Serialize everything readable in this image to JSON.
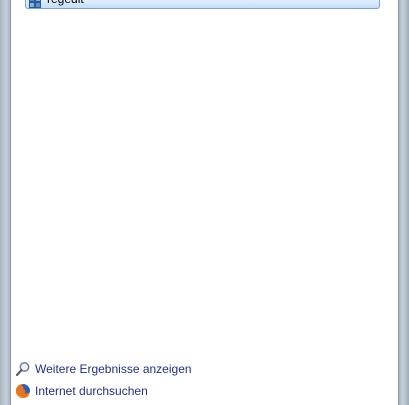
{
  "results": {
    "items": [
      {
        "label": "regedit",
        "icon": "registry-editor-icon"
      }
    ]
  },
  "footer": {
    "more_results_label": "Weitere Ergebnisse anzeigen",
    "more_results_icon": "search-icon",
    "search_internet_label": "Internet durchsuchen",
    "search_internet_icon": "firefox-icon"
  },
  "colors": {
    "link": "#1e3287",
    "highlight_border": "#7da2ce",
    "highlight_fill": "#dcebfc"
  }
}
